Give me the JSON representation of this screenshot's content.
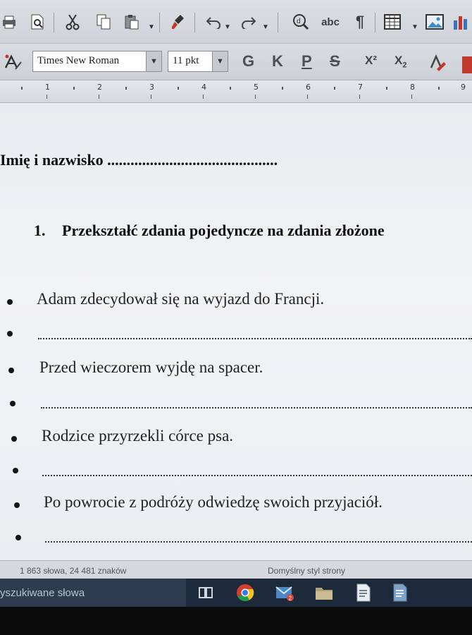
{
  "toolbar_top": {
    "icons": [
      "print-icon",
      "print-preview-icon",
      "cut-icon",
      "copy-icon",
      "paste-icon",
      "clone-formatting-icon",
      "undo-icon",
      "redo-icon",
      "find-replace-icon",
      "spellcheck-icon",
      "formatting-marks-icon",
      "table-icon",
      "image-icon",
      "chart-icon"
    ],
    "spellcheck_glyph": "abc"
  },
  "toolbar_format": {
    "font_name": "Times New Roman",
    "font_size": "11 pkt",
    "bold_label": "G",
    "italic_label": "K",
    "underline_label": "P",
    "strike_label": "S",
    "superscript_label": "X²",
    "subscript_base": "X",
    "subscript_index": "2"
  },
  "ruler": {
    "numbers": [
      "1",
      "2",
      "3",
      "4",
      "5",
      "6",
      "7",
      "8",
      "9"
    ]
  },
  "document": {
    "name_line": "Imię i nazwisko ............................................",
    "task_number": "1.",
    "task_text": "Przekształć zdania pojedyncze na zdania złożone",
    "sentences": [
      "Adam zdecydował się na wyjazd do Francji.",
      "Przed wieczorem wyjdę na spacer.",
      "Rodzice przyrzekli córce psa.",
      "Po powrocie z podróży odwiedzę swoich przyjaciół."
    ]
  },
  "status_bar": {
    "word_count": "1 863 słowa, 24 481 znaków",
    "page_style": "Domyślny styl strony"
  },
  "taskbar": {
    "search_placeholder": "yszukiwane słowa",
    "mail_badge": "2"
  }
}
